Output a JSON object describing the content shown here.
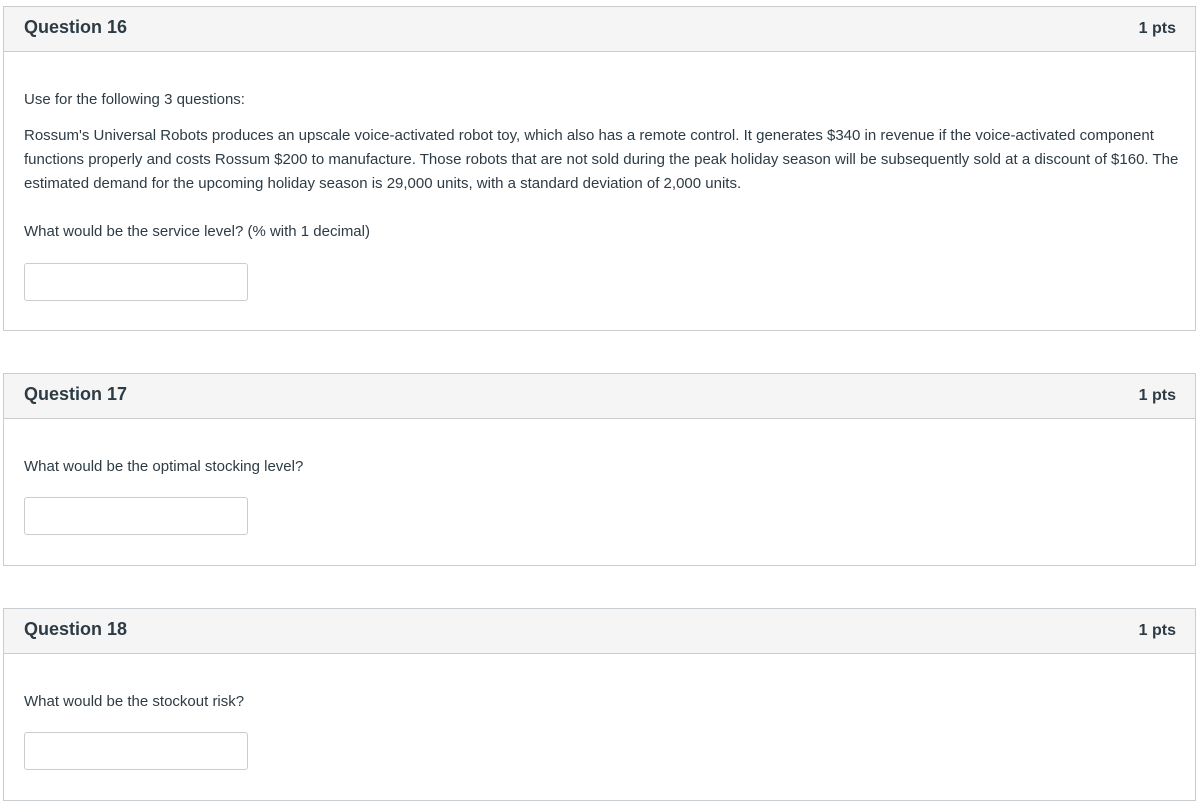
{
  "questions": [
    {
      "title": "Question 16",
      "points": "1 pts",
      "intro": "Use for the following 3 questions:",
      "scenario": "Rossum's Universal Robots produces an upscale voice-activated robot toy, which also has a remote control. It generates $340 in revenue if the voice-activated component functions properly and costs Rossum $200 to manufacture. Those robots that are not sold during the peak holiday season will be subsequently sold at a discount of $160. The estimated demand for the upcoming holiday season is 29,000 units, with a standard deviation of 2,000 units.",
      "prompt": "What would be the service level? (% with 1 decimal)",
      "answer_value": ""
    },
    {
      "title": "Question 17",
      "points": "1 pts",
      "prompt": "What would be the optimal stocking level?",
      "answer_value": ""
    },
    {
      "title": "Question 18",
      "points": "1 pts",
      "prompt": "What would be the stockout risk?",
      "answer_value": ""
    }
  ]
}
